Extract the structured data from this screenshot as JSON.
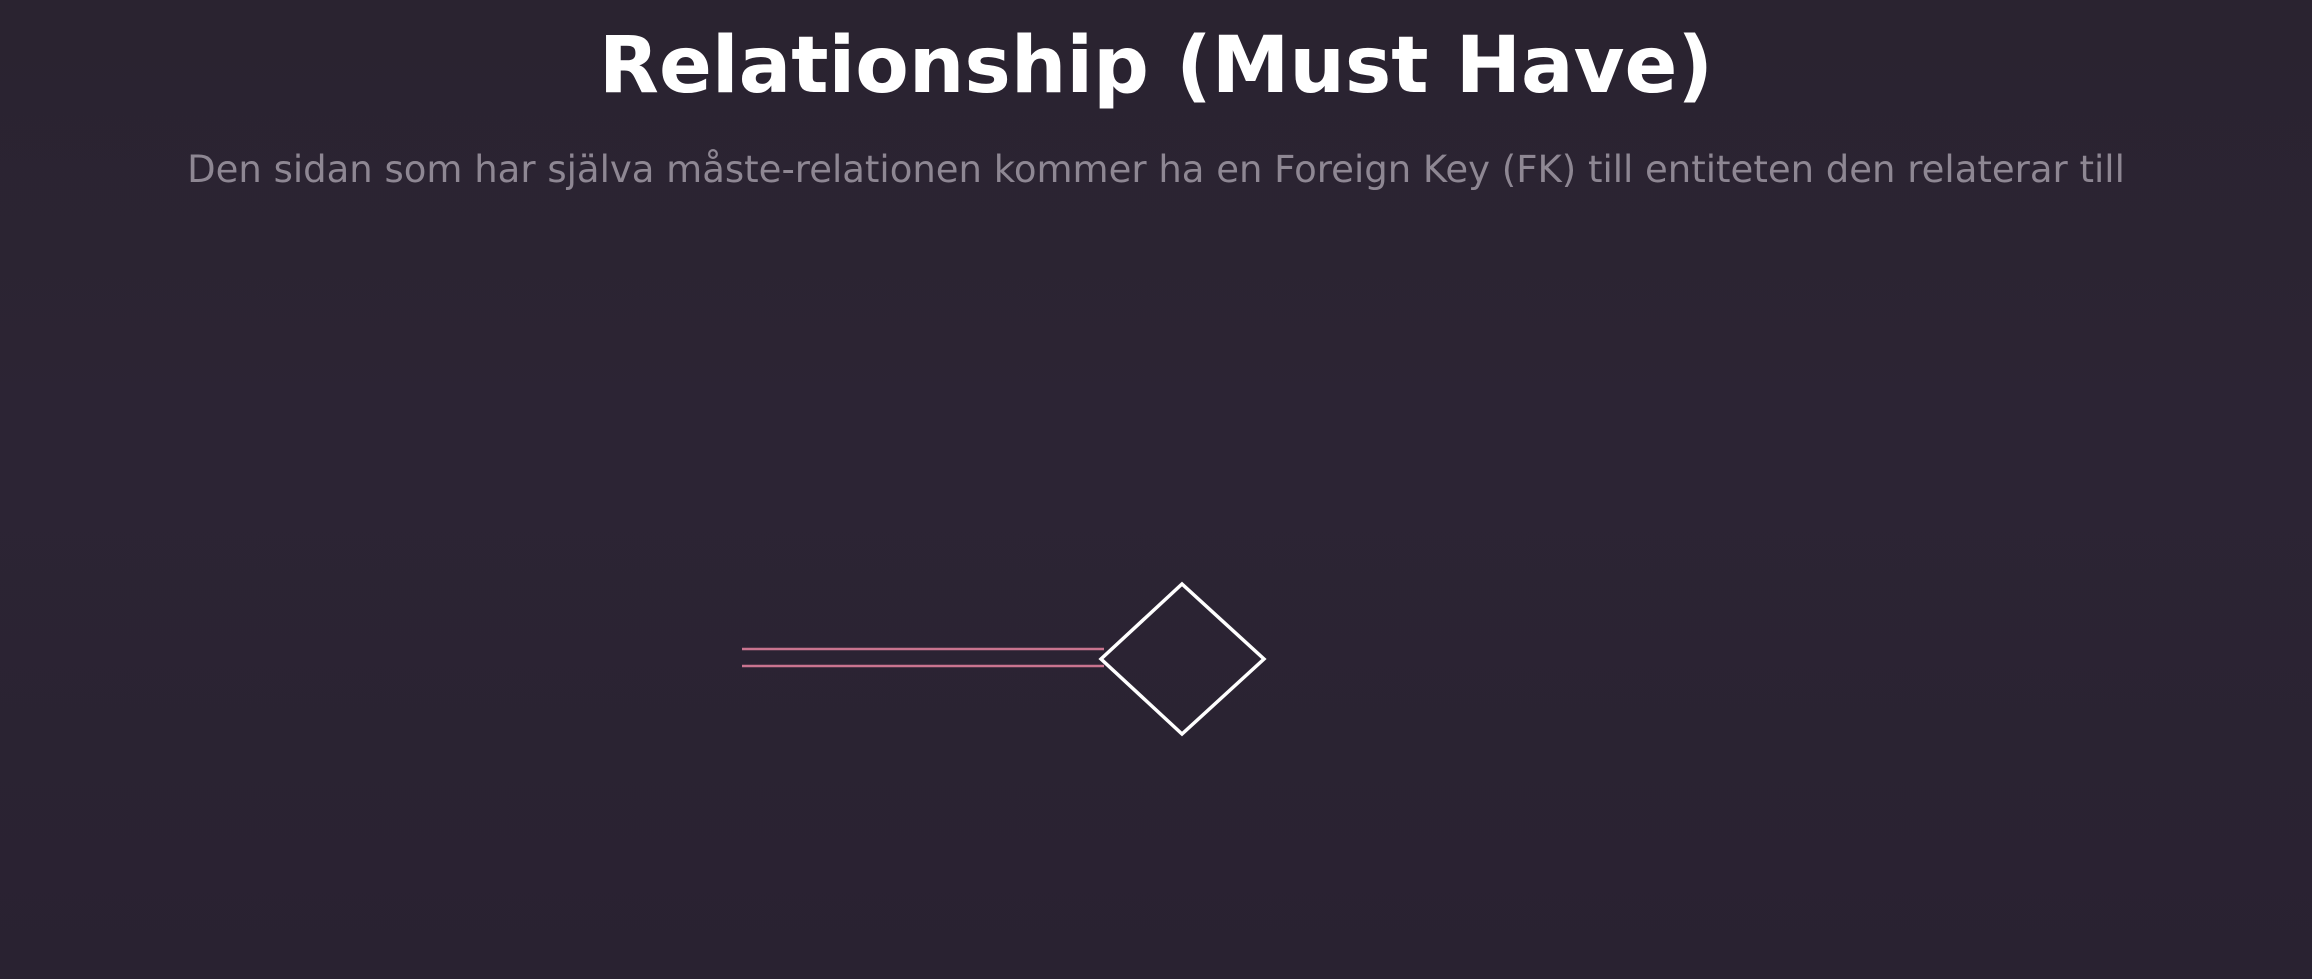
{
  "slide": {
    "title": "Relationship (Must Have)",
    "subtitle": "Den sidan som har själva måste-relationen kommer ha en Foreign Key (FK) till entiteten den relaterar till"
  },
  "diagram": {
    "connector_color": "#c9748f",
    "diamond_stroke_color": "#ffffff",
    "connector_style": "double-line",
    "shape": "diamond"
  }
}
